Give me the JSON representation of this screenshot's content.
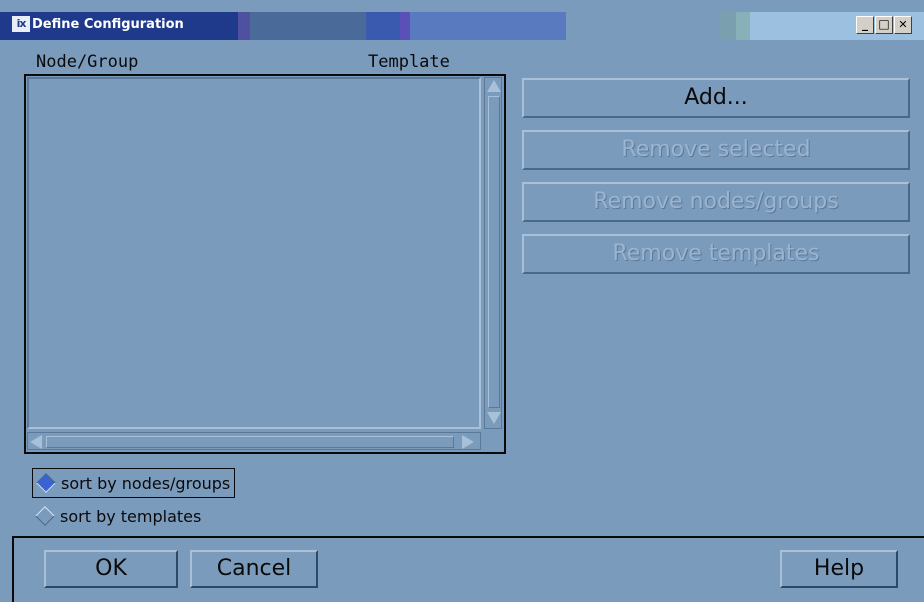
{
  "window": {
    "icon_glyph": "ix",
    "title": "Define Configuration",
    "minimize_glyph": "_",
    "maximize_glyph": "□",
    "close_glyph": "✕"
  },
  "list": {
    "columns": [
      "Node/Group",
      "Template"
    ],
    "rows": []
  },
  "actions": {
    "add_label": "Add...",
    "remove_selected_label": "Remove selected",
    "remove_nodes_label": "Remove nodes/groups",
    "remove_templates_label": "Remove templates"
  },
  "sort": {
    "options": [
      "sort by nodes/groups",
      "sort by templates"
    ],
    "selected": "sort by nodes/groups"
  },
  "footer": {
    "ok_label": "OK",
    "cancel_label": "Cancel",
    "help_label": "Help"
  },
  "colors": {
    "background": "#7b9bbd",
    "titlebar_active": "#1f3a8a",
    "radio_selected": "#3a62d0",
    "disabled_text": "#9bb4cf"
  }
}
